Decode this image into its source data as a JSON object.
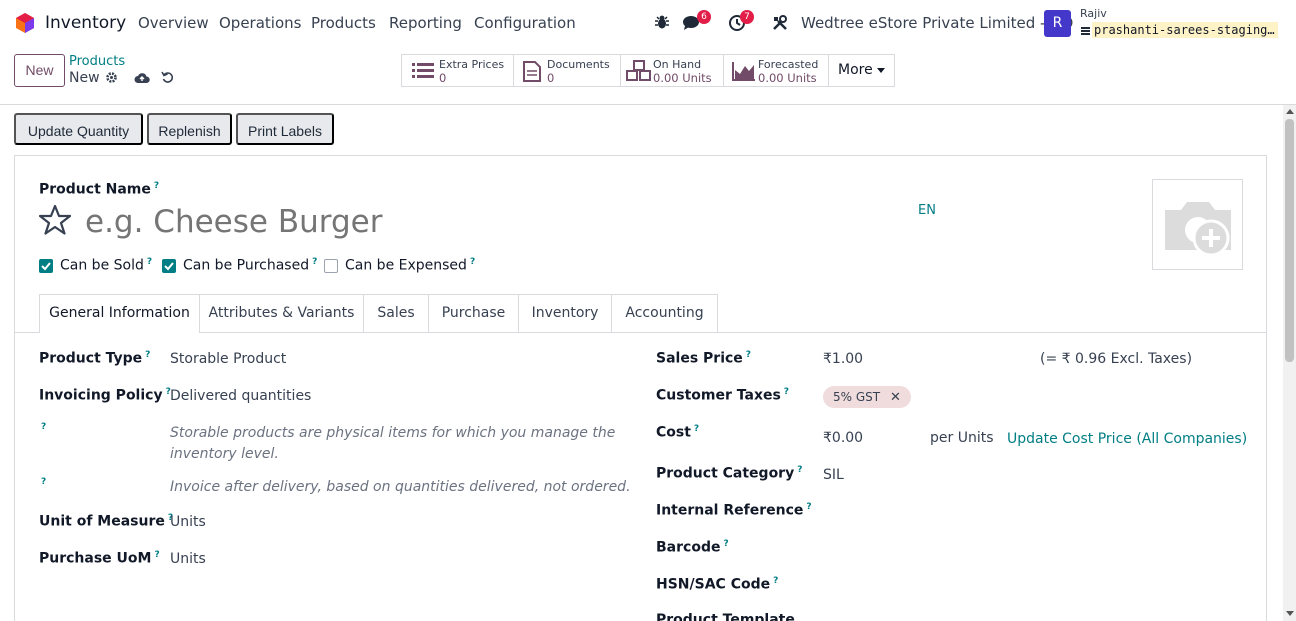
{
  "navbar": {
    "app_name": "Inventory",
    "menus": [
      "Overview",
      "Operations",
      "Products",
      "Reporting",
      "Configuration"
    ],
    "messages_count": "6",
    "activities_count": "7",
    "company": "Wedtree eStore Private Limited - HO",
    "user_initial": "R",
    "user_name": "Rajiv",
    "database": "prashanti-sarees-staging…"
  },
  "control": {
    "new_label": "New",
    "breadcrumb_parent": "Products",
    "breadcrumb_current": "New",
    "smart_buttons": [
      {
        "label": "Extra Prices",
        "value": "0"
      },
      {
        "label": "Documents",
        "value": "0"
      },
      {
        "label": "On Hand",
        "value": "0.00 Units"
      },
      {
        "label": "Forecasted",
        "value": "0.00 Units"
      }
    ],
    "more_label": "More"
  },
  "actions": [
    "Update Quantity",
    "Replenish",
    "Print Labels"
  ],
  "form": {
    "product_name_label": "Product Name",
    "product_name_placeholder": "e.g. Cheese Burger",
    "lang": "EN",
    "checkboxes": [
      {
        "label": "Can be Sold",
        "checked": true
      },
      {
        "label": "Can be Purchased",
        "checked": true
      },
      {
        "label": "Can be Expensed",
        "checked": false
      }
    ],
    "tabs": [
      "General Information",
      "Attributes & Variants",
      "Sales",
      "Purchase",
      "Inventory",
      "Accounting"
    ],
    "left": {
      "product_type_label": "Product Type",
      "product_type_value": "Storable Product",
      "invoicing_policy_label": "Invoicing Policy",
      "invoicing_policy_value": "Delivered quantities",
      "help_storable": "Storable products are physical items for which you manage the inventory level.",
      "help_invoice": "Invoice after delivery, based on quantities delivered, not ordered.",
      "uom_label": "Unit of Measure",
      "uom_value": "Units",
      "purchase_uom_label": "Purchase UoM",
      "purchase_uom_value": "Units"
    },
    "right": {
      "sales_price_label": "Sales Price",
      "sales_price_value": "₹1.00",
      "sales_price_excl": "(= ₹ 0.96 Excl. Taxes)",
      "customer_taxes_label": "Customer Taxes",
      "customer_taxes_tag": "5% GST",
      "cost_label": "Cost",
      "cost_value": "₹0.00",
      "cost_per": "per Units",
      "update_cost_link": "Update Cost Price (All Companies)",
      "category_label": "Product Category",
      "category_value": "SIL",
      "internal_ref_label": "Internal Reference",
      "barcode_label": "Barcode",
      "hsn_label": "HSN/SAC Code",
      "template_label": "Product Template"
    }
  },
  "colors": {
    "brand": "#714b67",
    "accent": "#017e84",
    "badge": "#e11d48"
  }
}
